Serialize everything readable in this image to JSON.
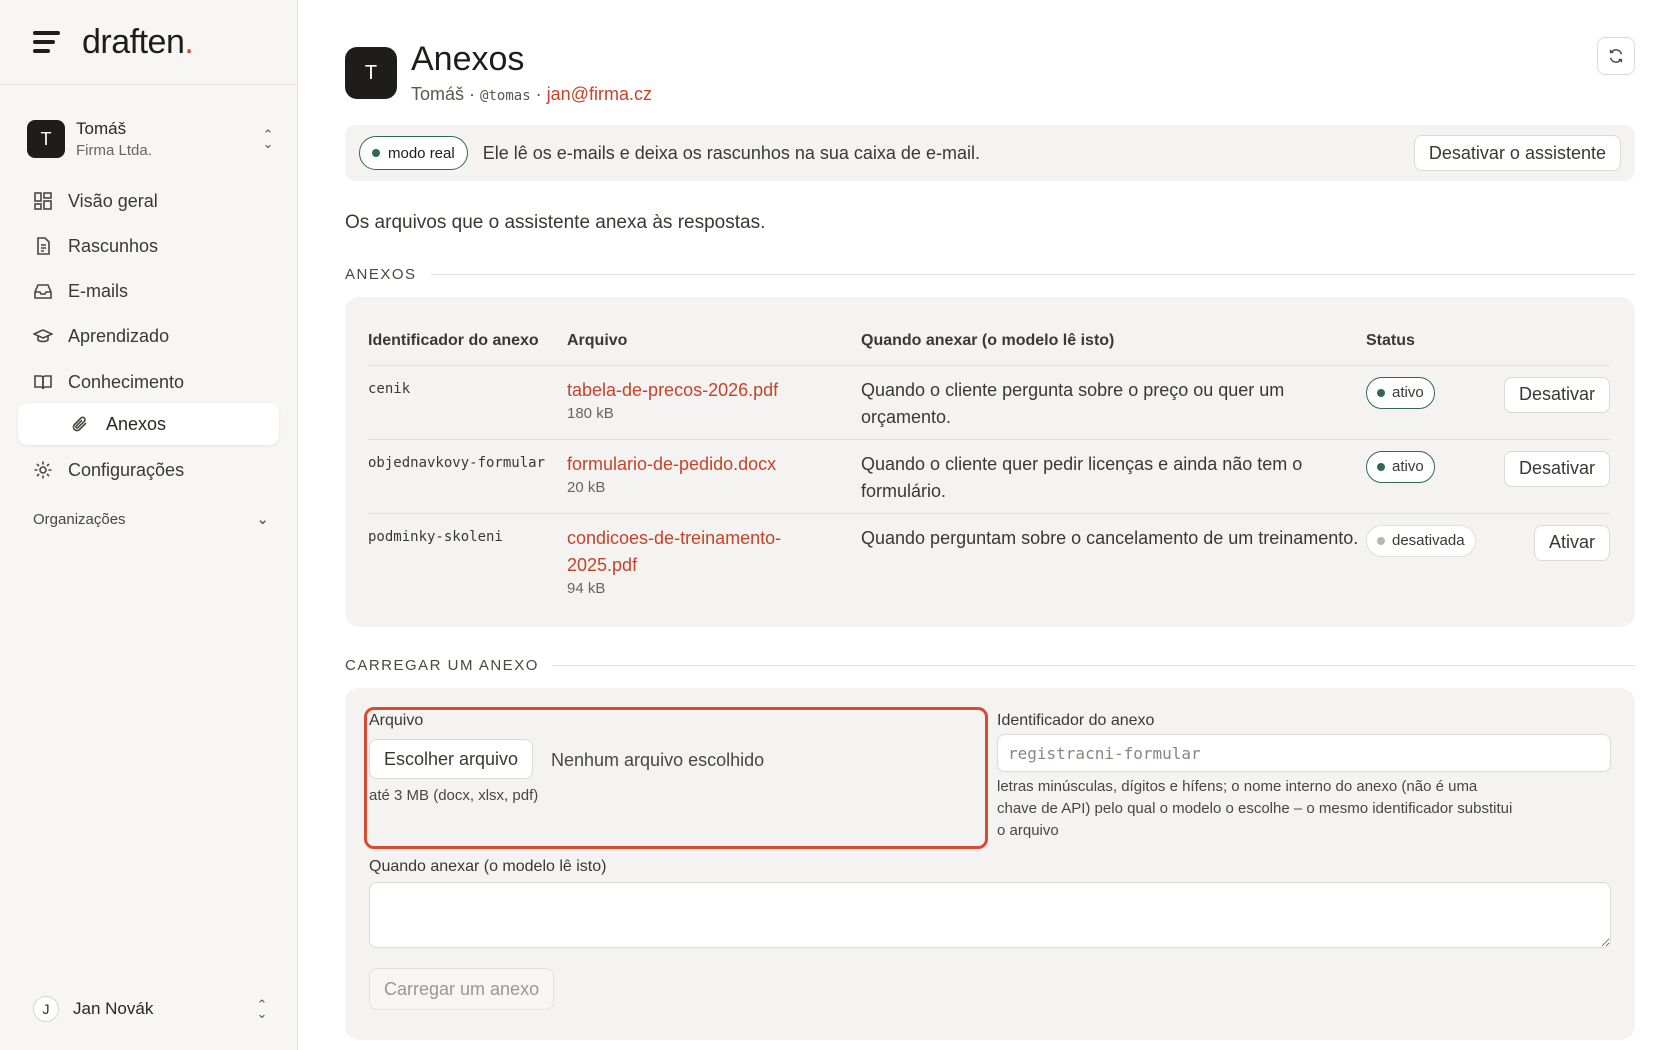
{
  "brand": {
    "name": "draften",
    "dot": "."
  },
  "account": {
    "initial": "T",
    "name": "Tomáš",
    "org": "Firma Ltda."
  },
  "nav": {
    "overview": "Visão geral",
    "drafts": "Rascunhos",
    "emails": "E-mails",
    "learning": "Aprendizado",
    "knowledge": "Conhecimento",
    "attachments": "Anexos",
    "settings": "Configurações",
    "organizations": "Organizações"
  },
  "footer_user": {
    "initial": "J",
    "name": "Jan Novák"
  },
  "header": {
    "initial": "T",
    "title": "Anexos",
    "user_name": "Tomáš",
    "separator": "·",
    "handle": "@tomas",
    "email": "jan@firma.cz"
  },
  "banner": {
    "mode": "modo real",
    "message": "Ele lê os e-mails e deixa os rascunhos na sua caixa de e-mail.",
    "disable_button": "Desativar o assistente"
  },
  "intro": "Os arquivos que o assistente anexa às respostas.",
  "attachments_section": {
    "label": "ANEXOS",
    "columns": [
      "Identificador do anexo",
      "Arquivo",
      "Quando anexar (o modelo lê isto)",
      "Status",
      ""
    ],
    "rows": [
      {
        "id": "cenik",
        "file": "tabela-de-precos-2026.pdf",
        "size": "180 kB",
        "when": "Quando o cliente pergunta sobre o preço ou quer um orçamento.",
        "status": "ativo",
        "action": "Desativar"
      },
      {
        "id": "objednavkovy-formular",
        "file": "formulario-de-pedido.docx",
        "size": "20 kB",
        "when": "Quando o cliente quer pedir licenças e ainda não tem o formulário.",
        "status": "ativo",
        "action": "Desativar"
      },
      {
        "id": "podminky-skoleni",
        "file": "condicoes-de-treinamento-2025.pdf",
        "size": "94 kB",
        "when": "Quando perguntam sobre o cancelamento de um treinamento.",
        "status": "desativada",
        "action": "Ativar"
      }
    ]
  },
  "upload_section": {
    "label": "CARREGAR UM ANEXO",
    "file_label": "Arquivo",
    "choose_button": "Escolher arquivo",
    "no_file": "Nenhum arquivo escolhido",
    "file_hint": "até 3 MB (docx, xlsx, pdf)",
    "id_label": "Identificador do anexo",
    "id_placeholder": "registracni-formular",
    "id_hint": "letras minúsculas, dígitos e hífens; o nome interno do anexo (não é uma chave de API) pelo qual o modelo o escolhe – o mesmo identificador substitui o arquivo",
    "when_label": "Quando anexar (o modelo lê isto)",
    "submit_button": "Carregar um anexo"
  },
  "colors": {
    "accent": "#c4432a",
    "active_green": "#2f6b4b",
    "highlight": "#d94a33"
  }
}
